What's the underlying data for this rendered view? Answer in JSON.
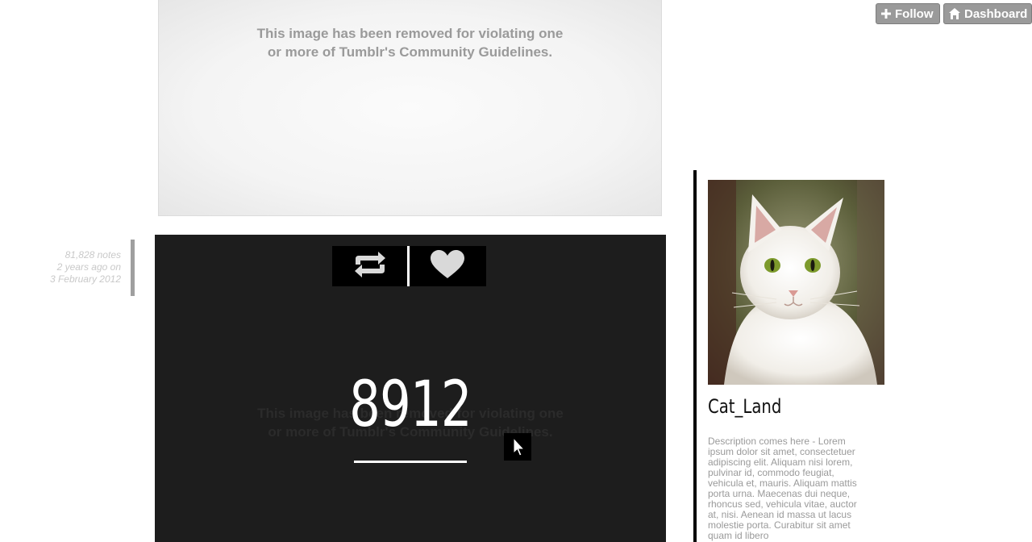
{
  "header": {
    "follow_label": "Follow",
    "dashboard_label": "Dashboard",
    "follow_icon": "plus-icon",
    "dashboard_icon": "home-icon"
  },
  "posts": [
    {
      "removed_notice_line1": "This image has been removed for violating one",
      "removed_notice_line2": "or more of Tumblr's Community Guidelines."
    },
    {
      "notes": "81,828 notes",
      "age": "2 years ago on",
      "date": "3 February 2012",
      "removed_notice_line1": "This image has been removed for violating one",
      "removed_notice_line2": "or more of Tumblr's Community Guidelines.",
      "note_count": "8912",
      "reblog_icon": "reblog-icon",
      "like_icon": "heart-icon"
    }
  ],
  "sidebar": {
    "title": "Cat_Land",
    "description": "Description comes here - Lorem ipsum dolor sit amet, consectetuer adipiscing elit. Aliquam nisi lorem, pulvinar id, commodo feugiat, vehicula et, mauris. Aliquam mattis porta urna. Maecenas dui neque, rhoncus sed, vehicula vitae, auctor at, nisi. Aenean id massa ut lacus molestie porta. Curabitur sit amet quam id libero"
  },
  "colors": {
    "button_bg": "#9a9a9a",
    "post_dark_bg": "#1d1d1d",
    "meta_text": "#c9c9c9",
    "description_text": "#9a9a9a"
  }
}
